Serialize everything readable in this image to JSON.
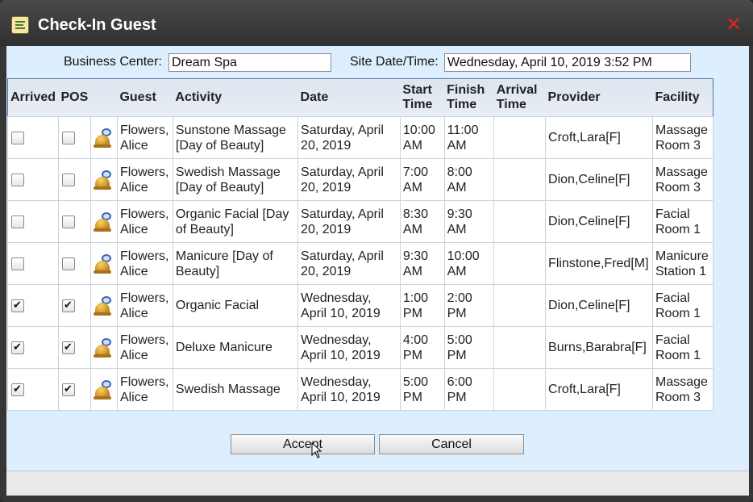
{
  "window": {
    "title": "Check-In Guest",
    "close_symbol": "✕"
  },
  "header": {
    "business_center_label": "Business Center:",
    "business_center_value": "Dream Spa",
    "site_datetime_label": "Site Date/Time:",
    "site_datetime_value": "Wednesday, April 10, 2019 3:52 PM"
  },
  "table": {
    "columns": {
      "arrived": "Arrived",
      "pos": "POS",
      "guest": "Guest",
      "activity": "Activity",
      "date": "Date",
      "start_a": "Start",
      "start_b": "Time",
      "finish_a": "Finish",
      "finish_b": "Time",
      "arrival_a": "Arrival",
      "arrival_b": "Time",
      "provider": "Provider",
      "facility": "Facility"
    },
    "rows": [
      {
        "arrived": false,
        "pos": false,
        "guest": "Flowers, Alice",
        "activity": "Sunstone Massage [Day of Beauty]",
        "date": "Saturday, April 20, 2019",
        "start": "10:00 AM",
        "finish": "11:00 AM",
        "arrival": "",
        "provider": "Croft,Lara[F]",
        "facility": "Massage Room 3"
      },
      {
        "arrived": false,
        "pos": false,
        "guest": "Flowers, Alice",
        "activity": "Swedish Massage [Day of Beauty]",
        "date": "Saturday, April 20, 2019",
        "start": "7:00 AM",
        "finish": "8:00 AM",
        "arrival": "",
        "provider": "Dion,Celine[F]",
        "facility": "Massage Room 3"
      },
      {
        "arrived": false,
        "pos": false,
        "guest": "Flowers, Alice",
        "activity": "Organic Facial [Day of Beauty]",
        "date": "Saturday, April 20, 2019",
        "start": "8:30 AM",
        "finish": "9:30 AM",
        "arrival": "",
        "provider": "Dion,Celine[F]",
        "facility": "Facial Room 1"
      },
      {
        "arrived": false,
        "pos": false,
        "guest": "Flowers, Alice",
        "activity": "Manicure [Day of Beauty]",
        "date": "Saturday, April 20, 2019",
        "start": "9:30 AM",
        "finish": "10:00 AM",
        "arrival": "",
        "provider": "Flinstone,Fred[M]",
        "facility": "Manicure Station 1"
      },
      {
        "arrived": true,
        "pos": true,
        "guest": "Flowers, Alice",
        "activity": "Organic Facial",
        "date": "Wednesday, April 10, 2019",
        "start": "1:00 PM",
        "finish": "2:00 PM",
        "arrival": "",
        "provider": "Dion,Celine[F]",
        "facility": "Facial Room 1"
      },
      {
        "arrived": true,
        "pos": true,
        "guest": "Flowers, Alice",
        "activity": "Deluxe Manicure",
        "date": "Wednesday, April 10, 2019",
        "start": "4:00 PM",
        "finish": "5:00 PM",
        "arrival": "",
        "provider": "Burns,Barabra[F]",
        "facility": "Facial Room 1"
      },
      {
        "arrived": true,
        "pos": true,
        "guest": "Flowers, Alice",
        "activity": "Swedish Massage",
        "date": "Wednesday, April 10, 2019",
        "start": "5:00 PM",
        "finish": "6:00 PM",
        "arrival": "",
        "provider": "Croft,Lara[F]",
        "facility": "Massage Room 3"
      }
    ]
  },
  "buttons": {
    "accept": "Accept",
    "cancel": "Cancel"
  }
}
